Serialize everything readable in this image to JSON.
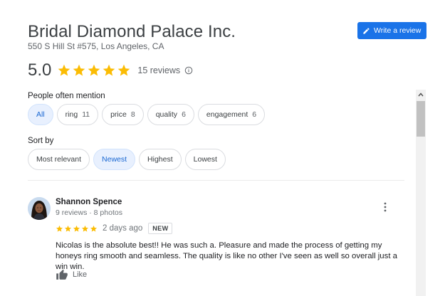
{
  "header": {
    "business_name": "Bridal Diamond Palace Inc.",
    "address": "550 S Hill St #575, Los Angeles, CA",
    "write_review_label": "Write a review"
  },
  "rating": {
    "value": "5.0",
    "stars": 5,
    "review_count": "15 reviews",
    "star_color": "#fbbc04"
  },
  "mentions": {
    "label": "People often mention",
    "chips": [
      {
        "label": "All",
        "count": "",
        "selected": true
      },
      {
        "label": "ring",
        "count": "11",
        "selected": false
      },
      {
        "label": "price",
        "count": "8",
        "selected": false
      },
      {
        "label": "quality",
        "count": "6",
        "selected": false
      },
      {
        "label": "engagement",
        "count": "6",
        "selected": false
      }
    ]
  },
  "sort": {
    "label": "Sort by",
    "options": [
      {
        "label": "Most relevant",
        "selected": false
      },
      {
        "label": "Newest",
        "selected": true
      },
      {
        "label": "Highest",
        "selected": false
      },
      {
        "label": "Lowest",
        "selected": false
      }
    ]
  },
  "review": {
    "author": "Shannon Spence",
    "meta": "9 reviews · 8 photos",
    "stars": 5,
    "date": "2 days ago",
    "badge": "NEW",
    "text": "Nicolas is the absolute best!! He was such a. Pleasure and made the process of getting my honeys ring smooth and seamless. The quality is like no other I've seen as well so overall just a win win.",
    "like_label": "Like"
  },
  "colors": {
    "accent": "#1a73e8",
    "selected_chip_bg": "#e8f0fe",
    "selected_chip_text": "#1967d2"
  }
}
